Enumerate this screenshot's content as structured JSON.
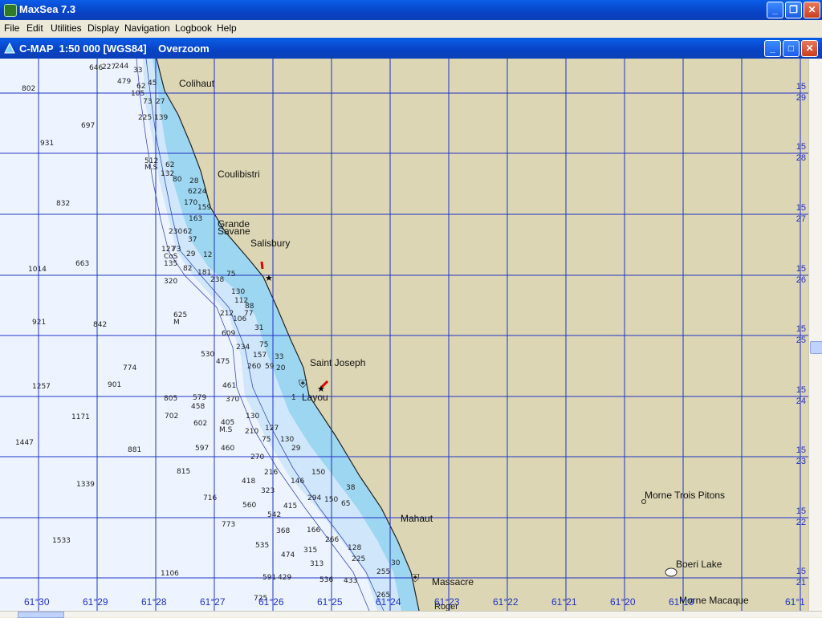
{
  "app": {
    "title": "MaxSea 7.3"
  },
  "menu": [
    "File",
    "Edit",
    "Utilities",
    "Display",
    "Navigation",
    "Logbook",
    "Help"
  ],
  "chart_window": {
    "title": "C-MAP  1:50 000 [WGS84]    Overzoom"
  },
  "colors": {
    "land": "#dcd6b4",
    "deep": "#eef4ff",
    "mid": "#cfe6fb",
    "shallow": "#9cd6f0",
    "grid": "#1f33c4",
    "titlebar": "#0a4fd8"
  },
  "place_names": [
    {
      "label": "Colihaut"
    },
    {
      "label": "Coulibistri"
    },
    {
      "label": "Grande"
    },
    {
      "label": "Savane"
    },
    {
      "label": "Salisbury"
    },
    {
      "label": "Saint Joseph"
    },
    {
      "label": "Layou"
    },
    {
      "label": "Mahaut"
    },
    {
      "label": "Massacre"
    },
    {
      "label": "Morne Trois Pitons"
    },
    {
      "label": "Boeri Lake"
    },
    {
      "label": "Morne Macaque"
    }
  ],
  "lon_labels": [
    "61°30",
    "61°29",
    "61°28",
    "61°27",
    "61°26",
    "61°25",
    "61°24",
    "61°23",
    "61°22",
    "61°21",
    "61°20",
    "61°19",
    "61°1"
  ],
  "lat_labels": [
    {
      "deg": "15",
      "min": "29"
    },
    {
      "deg": "15",
      "min": "28"
    },
    {
      "deg": "15",
      "min": "27"
    },
    {
      "deg": "15",
      "min": "26"
    },
    {
      "deg": "15",
      "min": "25"
    },
    {
      "deg": "15",
      "min": "24"
    },
    {
      "deg": "15",
      "min": "23"
    },
    {
      "deg": "15",
      "min": "22"
    },
    {
      "deg": "15",
      "min": "21"
    }
  ],
  "soundings": [
    "802",
    "646",
    "227",
    "244",
    "33",
    "479",
    "62",
    "45",
    "105",
    "73",
    "27",
    "225",
    "139",
    "697",
    "931",
    "512",
    "M.S",
    "62",
    "132",
    "80",
    "28",
    "62",
    "24",
    "832",
    "170",
    "159",
    "163",
    "230",
    "62",
    "37",
    "1014",
    "663",
    "127",
    "73",
    "29",
    "12",
    "CoS",
    "135",
    "82",
    "181",
    "320",
    "238",
    "75",
    "130",
    "112",
    "88",
    "212",
    "106",
    "77",
    "625",
    "M",
    "921",
    "842",
    "31",
    "609",
    "234",
    "75",
    "530",
    "475",
    "157",
    "33",
    "774",
    "260",
    "59",
    "20",
    "461",
    "1257",
    "901",
    "805",
    "579",
    "370",
    "458",
    "702",
    "602",
    "405",
    "M.S",
    "1171",
    "130",
    "210",
    "127",
    "75",
    "130",
    "29",
    "1447",
    "597",
    "460",
    "881",
    "270",
    "216",
    "146",
    "150",
    "815",
    "418",
    "323",
    "38",
    "1339",
    "716",
    "560",
    "294",
    "150",
    "65",
    "415",
    "542",
    "773",
    "368",
    "166",
    "128",
    "1533",
    "535",
    "315",
    "266",
    "225",
    "474",
    "313",
    "30",
    "1106",
    "591",
    "429",
    "536",
    "433",
    "255",
    "725",
    "265"
  ],
  "chart_glyphs": [
    "1",
    "Roger"
  ]
}
